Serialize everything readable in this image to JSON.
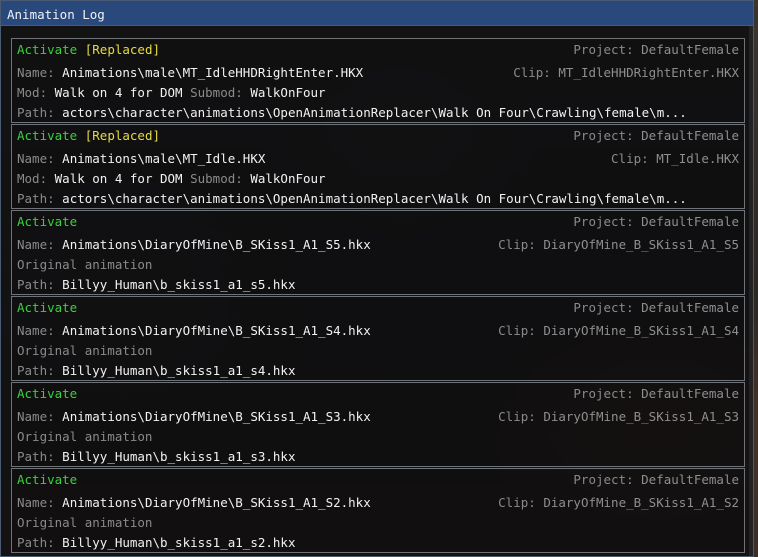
{
  "window": {
    "title": "Animation Log"
  },
  "labels": {
    "project": "Project:",
    "name": "Name:",
    "clip": "Clip:",
    "mod": "Mod:",
    "submod": "Submod:",
    "path": "Path:"
  },
  "entries": [
    {
      "status": "Activate",
      "tag": "[Replaced]",
      "project": "DefaultFemale",
      "name": "Animations\\male\\MT_IdleHHDRightEnter.HKX",
      "clip": "MT_IdleHHDRightEnter.HKX",
      "mod": "Walk on 4 for DOM",
      "submod": "WalkOnFour",
      "original": "",
      "path": "actors\\character\\animations\\OpenAnimationReplacer\\Walk On Four\\Crawling\\female\\m..."
    },
    {
      "status": "Activate",
      "tag": "[Replaced]",
      "project": "DefaultFemale",
      "name": "Animations\\male\\MT_Idle.HKX",
      "clip": "MT_Idle.HKX",
      "mod": "Walk on 4 for DOM",
      "submod": "WalkOnFour",
      "original": "",
      "path": "actors\\character\\animations\\OpenAnimationReplacer\\Walk On Four\\Crawling\\female\\m..."
    },
    {
      "status": "Activate",
      "tag": "",
      "project": "DefaultFemale",
      "name": "Animations\\DiaryOfMine\\B_SKiss1_A1_S5.hkx",
      "clip": "DiaryOfMine_B_SKiss1_A1_S5",
      "mod": "",
      "submod": "",
      "original": "Original animation",
      "path": "Billyy_Human\\b_skiss1_a1_s5.hkx"
    },
    {
      "status": "Activate",
      "tag": "",
      "project": "DefaultFemale",
      "name": "Animations\\DiaryOfMine\\B_SKiss1_A1_S4.hkx",
      "clip": "DiaryOfMine_B_SKiss1_A1_S4",
      "mod": "",
      "submod": "",
      "original": "Original animation",
      "path": "Billyy_Human\\b_skiss1_a1_s4.hkx"
    },
    {
      "status": "Activate",
      "tag": "",
      "project": "DefaultFemale",
      "name": "Animations\\DiaryOfMine\\B_SKiss1_A1_S3.hkx",
      "clip": "DiaryOfMine_B_SKiss1_A1_S3",
      "mod": "",
      "submod": "",
      "original": "Original animation",
      "path": "Billyy_Human\\b_skiss1_a1_s3.hkx"
    },
    {
      "status": "Activate",
      "tag": "",
      "project": "DefaultFemale",
      "name": "Animations\\DiaryOfMine\\B_SKiss1_A1_S2.hkx",
      "clip": "DiaryOfMine_B_SKiss1_A1_S2",
      "mod": "",
      "submod": "",
      "original": "Original animation",
      "path": "Billyy_Human\\b_skiss1_a1_s2.hkx"
    }
  ]
}
